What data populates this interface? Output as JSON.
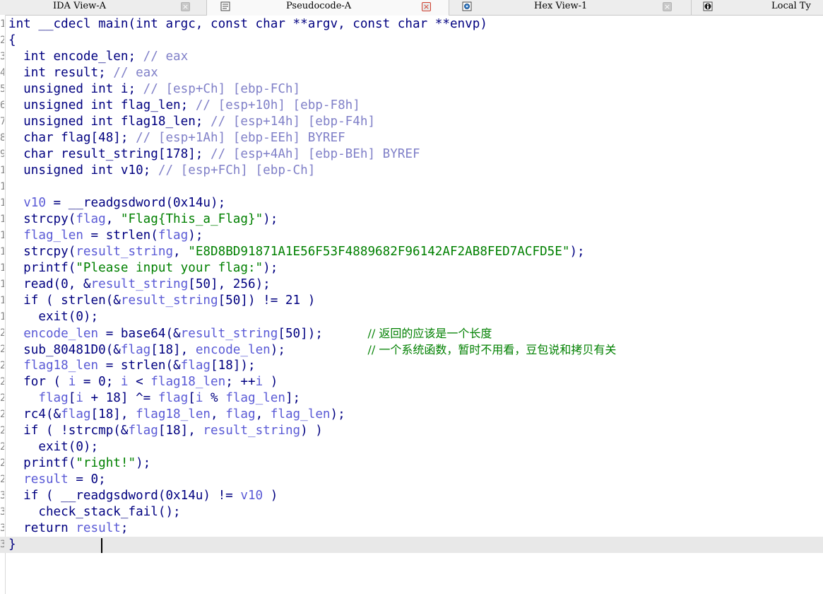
{
  "colors": {
    "keyword": "#000080",
    "ident": "#000080",
    "var": "#5a5ad6",
    "comment": "#8080c8",
    "string": "#008000",
    "zh_comment": "#008000",
    "number": "#000080"
  },
  "tabs": [
    {
      "label": "IDA View-A",
      "icon": "",
      "active": false
    },
    {
      "label": "Pseudocode-A",
      "icon": "pseudocode-icon",
      "active": true
    },
    {
      "label": "Hex View-1",
      "icon": "hex-view-icon",
      "active": false
    },
    {
      "label": "Local Ty",
      "icon": "local-types-icon",
      "active": false
    }
  ],
  "code_lines": [
    {
      "no": "1",
      "tokens": [
        [
          "int __cdecl main(int argc, const char **argv, const char **envp)",
          "k"
        ]
      ]
    },
    {
      "no": "2",
      "tokens": [
        [
          "{",
          "k"
        ]
      ]
    },
    {
      "no": "3",
      "tokens": [
        [
          "  int encode_len; ",
          "k"
        ],
        [
          "// eax",
          "c"
        ]
      ]
    },
    {
      "no": "4",
      "tokens": [
        [
          "  int result; ",
          "k"
        ],
        [
          "// eax",
          "c"
        ]
      ]
    },
    {
      "no": "5",
      "tokens": [
        [
          "  unsigned int i; ",
          "k"
        ],
        [
          "// [esp+Ch] [ebp-FCh]",
          "c"
        ]
      ]
    },
    {
      "no": "6",
      "tokens": [
        [
          "  unsigned int flag_len; ",
          "k"
        ],
        [
          "// [esp+10h] [ebp-F8h]",
          "c"
        ]
      ]
    },
    {
      "no": "7",
      "tokens": [
        [
          "  unsigned int flag18_len; ",
          "k"
        ],
        [
          "// [esp+14h] [ebp-F4h]",
          "c"
        ]
      ]
    },
    {
      "no": "8",
      "tokens": [
        [
          "  char flag[48]; ",
          "k"
        ],
        [
          "// [esp+1Ah] [ebp-EEh] BYREF",
          "c"
        ]
      ]
    },
    {
      "no": "9",
      "tokens": [
        [
          "  char result_string[178]; ",
          "k"
        ],
        [
          "// [esp+4Ah] [ebp-BEh] BYREF",
          "c"
        ]
      ]
    },
    {
      "no": "10",
      "tokens": [
        [
          "  unsigned int v10; ",
          "k"
        ],
        [
          "// [esp+FCh] [ebp-Ch]",
          "c"
        ]
      ]
    },
    {
      "no": "11",
      "tokens": []
    },
    {
      "no": "12",
      "tokens": [
        [
          "  ",
          "k"
        ],
        [
          "v10",
          "v"
        ],
        [
          " = __readgsdword(0x14u);",
          "k"
        ]
      ]
    },
    {
      "no": "13",
      "tokens": [
        [
          "  strcpy(",
          "k"
        ],
        [
          "flag",
          "v"
        ],
        [
          ", ",
          "k"
        ],
        [
          "\"Flag{This_a_Flag}\"",
          "s"
        ],
        [
          ");",
          "k"
        ]
      ]
    },
    {
      "no": "14",
      "tokens": [
        [
          "  ",
          "k"
        ],
        [
          "flag_len",
          "v"
        ],
        [
          " = strlen(",
          "k"
        ],
        [
          "flag",
          "v"
        ],
        [
          ");",
          "k"
        ]
      ]
    },
    {
      "no": "15",
      "tokens": [
        [
          "  strcpy(",
          "k"
        ],
        [
          "result_string",
          "v"
        ],
        [
          ", ",
          "k"
        ],
        [
          "\"E8D8BD91871A1E56F53F4889682F96142AF2AB8FED7ACFD5E\"",
          "s"
        ],
        [
          ");",
          "k"
        ]
      ]
    },
    {
      "no": "16",
      "tokens": [
        [
          "  printf(",
          "k"
        ],
        [
          "\"Please input your flag:\"",
          "s"
        ],
        [
          ");",
          "k"
        ]
      ]
    },
    {
      "no": "17",
      "tokens": [
        [
          "  read(0, &",
          "k"
        ],
        [
          "result_string",
          "v"
        ],
        [
          "[50], 256);",
          "k"
        ]
      ]
    },
    {
      "no": "18",
      "tokens": [
        [
          "  if ( strlen(&",
          "k"
        ],
        [
          "result_string",
          "v"
        ],
        [
          "[50]) != 21 )",
          "k"
        ]
      ]
    },
    {
      "no": "19",
      "tokens": [
        [
          "    exit(0);",
          "k"
        ]
      ]
    },
    {
      "no": "20",
      "tokens": [
        [
          "  ",
          "k"
        ],
        [
          "encode_len",
          "v"
        ],
        [
          " = base64(&",
          "k"
        ],
        [
          "result_string",
          "v"
        ],
        [
          "[50]);      ",
          "k"
        ],
        [
          "// 返回的应该是一个长度",
          "z"
        ]
      ]
    },
    {
      "no": "21",
      "tokens": [
        [
          "  sub_80481D0(&",
          "k"
        ],
        [
          "flag",
          "v"
        ],
        [
          "[18], ",
          "k"
        ],
        [
          "encode_len",
          "v"
        ],
        [
          ");           ",
          "k"
        ],
        [
          "// 一个系统函数，暂时不用看，豆包说和拷贝有关",
          "z"
        ]
      ]
    },
    {
      "no": "22",
      "tokens": [
        [
          "  ",
          "k"
        ],
        [
          "flag18_len",
          "v"
        ],
        [
          " = strlen(&",
          "k"
        ],
        [
          "flag",
          "v"
        ],
        [
          "[18]);",
          "k"
        ]
      ]
    },
    {
      "no": "23",
      "tokens": [
        [
          "  for ( ",
          "k"
        ],
        [
          "i",
          "v"
        ],
        [
          " = 0; ",
          "k"
        ],
        [
          "i",
          "v"
        ],
        [
          " < ",
          "k"
        ],
        [
          "flag18_len",
          "v"
        ],
        [
          "; ++",
          "k"
        ],
        [
          "i",
          "v"
        ],
        [
          " )",
          "k"
        ]
      ]
    },
    {
      "no": "24",
      "tokens": [
        [
          "    ",
          "k"
        ],
        [
          "flag",
          "v"
        ],
        [
          "[",
          "k"
        ],
        [
          "i",
          "v"
        ],
        [
          " + 18] ^= ",
          "k"
        ],
        [
          "flag",
          "v"
        ],
        [
          "[",
          "k"
        ],
        [
          "i",
          "v"
        ],
        [
          " % ",
          "k"
        ],
        [
          "flag_len",
          "v"
        ],
        [
          "];",
          "k"
        ]
      ]
    },
    {
      "no": "25",
      "tokens": [
        [
          "  rc4(&",
          "k"
        ],
        [
          "flag",
          "v"
        ],
        [
          "[18], ",
          "k"
        ],
        [
          "flag18_len",
          "v"
        ],
        [
          ", ",
          "k"
        ],
        [
          "flag",
          "v"
        ],
        [
          ", ",
          "k"
        ],
        [
          "flag_len",
          "v"
        ],
        [
          ");",
          "k"
        ]
      ]
    },
    {
      "no": "26",
      "tokens": [
        [
          "  if ( !strcmp(&",
          "k"
        ],
        [
          "flag",
          "v"
        ],
        [
          "[18], ",
          "k"
        ],
        [
          "result_string",
          "v"
        ],
        [
          ") )",
          "k"
        ]
      ]
    },
    {
      "no": "27",
      "tokens": [
        [
          "    exit(0);",
          "k"
        ]
      ]
    },
    {
      "no": "28",
      "tokens": [
        [
          "  printf(",
          "k"
        ],
        [
          "\"right!\"",
          "s"
        ],
        [
          ");",
          "k"
        ]
      ]
    },
    {
      "no": "29",
      "tokens": [
        [
          "  ",
          "k"
        ],
        [
          "result",
          "v"
        ],
        [
          " = 0;",
          "k"
        ]
      ]
    },
    {
      "no": "30",
      "tokens": [
        [
          "  if ( __readgsdword(0x14u) != ",
          "k"
        ],
        [
          "v10",
          "v"
        ],
        [
          " )",
          "k"
        ]
      ]
    },
    {
      "no": "31",
      "tokens": [
        [
          "    check_stack_fail();",
          "k"
        ]
      ]
    },
    {
      "no": "32",
      "tokens": [
        [
          "  return ",
          "k"
        ],
        [
          "result",
          "v"
        ],
        [
          ";",
          "k"
        ]
      ]
    },
    {
      "no": "33",
      "tokens": [
        [
          "}",
          "k"
        ]
      ],
      "current": true
    }
  ]
}
